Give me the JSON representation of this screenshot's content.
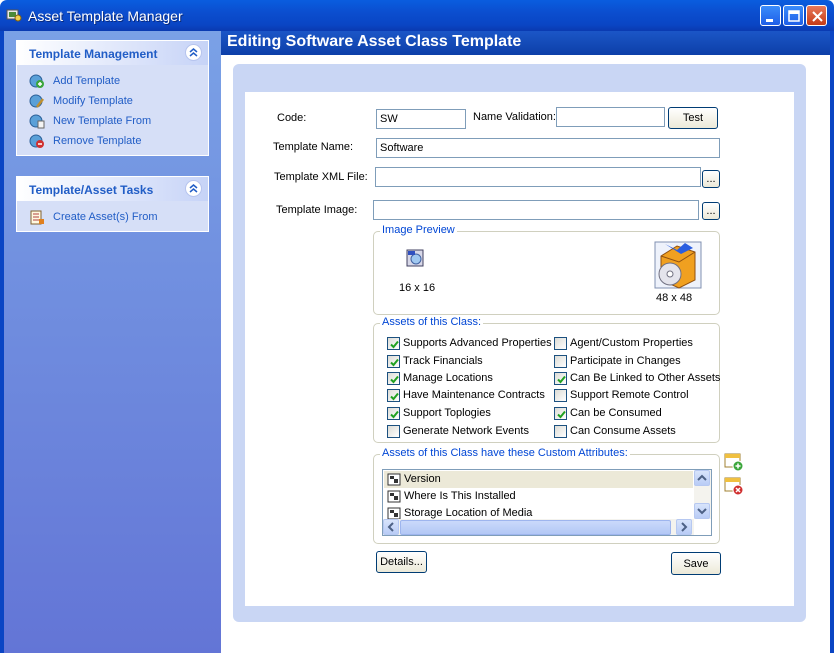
{
  "window": {
    "title": "Asset Template Manager",
    "icon": "app-icon"
  },
  "sidebar": {
    "template_management": {
      "title": "Template Management",
      "items": [
        {
          "label": "Add Template",
          "icon": "add-template-icon"
        },
        {
          "label": "Modify Template",
          "icon": "modify-template-icon"
        },
        {
          "label": "New Template From",
          "icon": "new-template-from-icon"
        },
        {
          "label": "Remove Template",
          "icon": "remove-template-icon"
        }
      ]
    },
    "asset_tasks": {
      "title": "Template/Asset Tasks",
      "items": [
        {
          "label": "Create Asset(s) From",
          "icon": "create-asset-icon"
        }
      ]
    }
  },
  "main": {
    "title": "Editing Software Asset Class Template",
    "form": {
      "code_label": "Code:",
      "code_value": "SW",
      "name_validation_label": "Name Validation:",
      "name_validation_value": "",
      "test_button": "Test",
      "template_name_label": "Template Name:",
      "template_name_value": "Software",
      "xml_file_label": "Template XML File:",
      "xml_file_value": "",
      "image_label": "Template Image:",
      "image_value": "",
      "browse_button": "..."
    },
    "image_preview": {
      "title": "Image Preview",
      "small_caption": "16 x 16",
      "large_caption": "48 x 48"
    },
    "assets_class": {
      "title": "Assets of this Class:",
      "checkboxes": [
        {
          "label": "Supports Advanced Properties",
          "checked": true
        },
        {
          "label": "Track Financials",
          "checked": true
        },
        {
          "label": "Manage Locations",
          "checked": true
        },
        {
          "label": "Have Maintenance Contracts",
          "checked": true
        },
        {
          "label": "Support Toplogies",
          "checked": true
        },
        {
          "label": "Generate Network Events",
          "checked": false
        },
        {
          "label": "Agent/Custom Properties",
          "checked": false
        },
        {
          "label": "Participate in Changes",
          "checked": false
        },
        {
          "label": "Can Be Linked to Other Assets",
          "checked": true
        },
        {
          "label": "Support Remote Control",
          "checked": false
        },
        {
          "label": "Can be Consumed",
          "checked": true
        },
        {
          "label": "Can Consume Assets",
          "checked": false
        }
      ]
    },
    "custom_attributes": {
      "title": "Assets of this Class have these Custom Attributes:",
      "items": [
        "Version",
        "Where Is This Installed",
        "Storage Location of Media"
      ]
    },
    "details_button": "Details...",
    "save_button": "Save"
  },
  "colors": {
    "titlebar": "#0a4ecf",
    "sidebar": "#6f8be0",
    "link": "#215dc6",
    "group_title": "#0046d5"
  }
}
